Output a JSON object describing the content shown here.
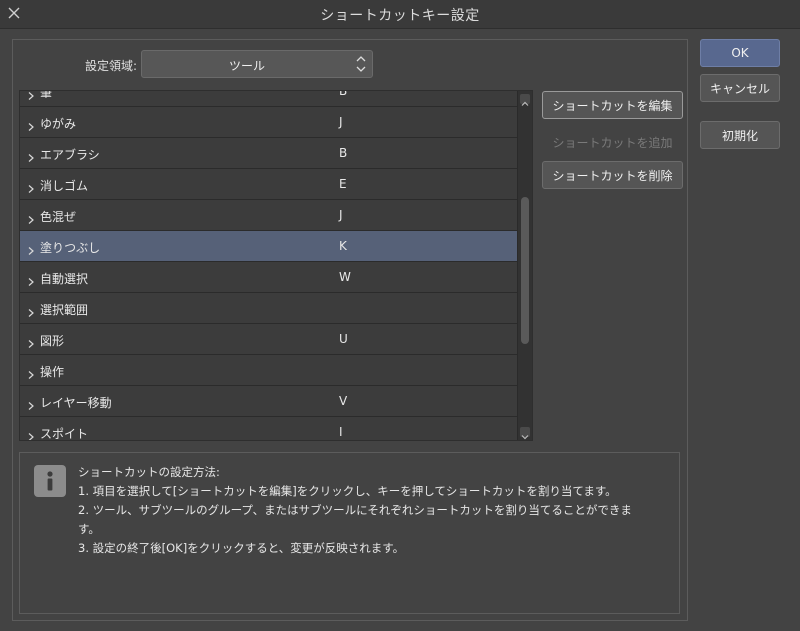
{
  "window": {
    "title": "ショートカットキー設定"
  },
  "domain": {
    "label": "設定領域:",
    "value": "ツール"
  },
  "list": {
    "rows": [
      {
        "name": "筆",
        "key": "B"
      },
      {
        "name": "ゆがみ",
        "key": "J"
      },
      {
        "name": "エアブラシ",
        "key": "B"
      },
      {
        "name": "消しゴム",
        "key": "E"
      },
      {
        "name": "色混ぜ",
        "key": "J"
      },
      {
        "name": "塗りつぶし",
        "key": "K",
        "selected": true
      },
      {
        "name": "自動選択",
        "key": "W"
      },
      {
        "name": "選択範囲",
        "key": ""
      },
      {
        "name": "図形",
        "key": "U"
      },
      {
        "name": "操作",
        "key": ""
      },
      {
        "name": "レイヤー移動",
        "key": "V"
      },
      {
        "name": "スポイト",
        "key": "I"
      }
    ]
  },
  "side_buttons": {
    "edit": "ショートカットを編集",
    "add": "ショートカットを追加",
    "delete": "ショートカットを削除"
  },
  "dialog_buttons": {
    "ok": "OK",
    "cancel": "キャンセル",
    "reset": "初期化"
  },
  "info": {
    "heading": "ショートカットの設定方法:",
    "line1": "1. 項目を選択して[ショートカットを編集]をクリックし、キーを押してショートカットを割り当てます。",
    "line2": "2. ツール、サブツールのグループ、またはサブツールにそれぞれショートカットを割り当てることができま",
    "line2b": "す。",
    "line3": "3. 設定の終了後[OK]をクリックすると、変更が反映されます。"
  },
  "colors": {
    "background": "#434343",
    "selected_row": "#566178",
    "primary_button": "#58688f"
  }
}
